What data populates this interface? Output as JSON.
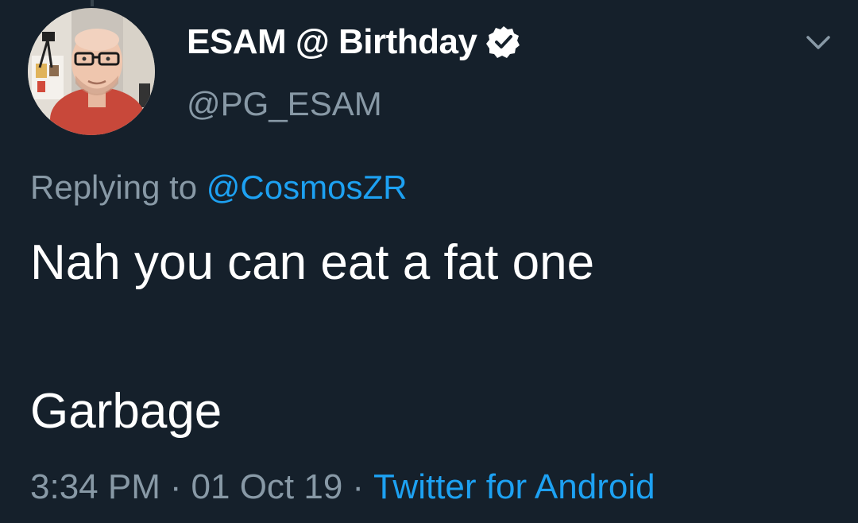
{
  "tweet": {
    "display_name": "ESAM @ Birthday",
    "handle": "@PG_ESAM",
    "replying_prefix": "Replying to",
    "replying_to": "@CosmosZR",
    "text_line_1": "Nah you can eat a fat one",
    "text_line_2": "Garbage",
    "time": "3:34 PM",
    "date": "01 Oct 19",
    "separator": "·",
    "source": "Twitter for Android"
  },
  "icons": {
    "verified": "verified-badge-icon",
    "more": "chevron-down-icon",
    "avatar": "avatar"
  },
  "colors": {
    "background": "#15202b",
    "text_primary": "#ffffff",
    "text_secondary": "#8899a6",
    "accent": "#1da1f2"
  }
}
